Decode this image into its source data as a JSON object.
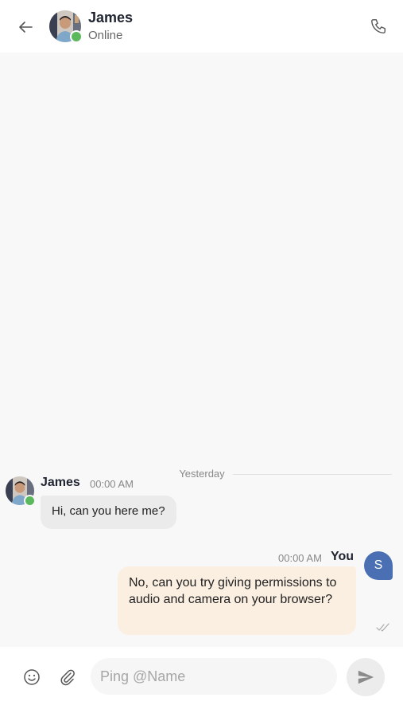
{
  "header": {
    "contact_name": "James",
    "contact_status": "Online",
    "icons": {
      "back": "arrow-left-icon",
      "call": "phone-icon"
    },
    "online_color": "#5cb85c"
  },
  "conversation": {
    "date_divider": "Yesterday",
    "messages": [
      {
        "sender": "James",
        "time": "00:00 AM",
        "text": "Hi, can you here me?",
        "direction": "incoming"
      },
      {
        "sender": "You",
        "avatar_initial": "S",
        "time": "00:00 AM",
        "text": "No, can you try giving permissions to audio and camera on your browser?",
        "direction": "outgoing",
        "status": "read"
      }
    ]
  },
  "composer": {
    "placeholder": "Ping @Name",
    "value": "",
    "icons": {
      "emoji": "smiley-icon",
      "attach": "paperclip-icon",
      "send": "send-icon"
    }
  },
  "colors": {
    "outgoing_bubble": "#fbefe2",
    "incoming_bubble": "#ebebeb",
    "self_avatar": "#4a6fb3"
  }
}
